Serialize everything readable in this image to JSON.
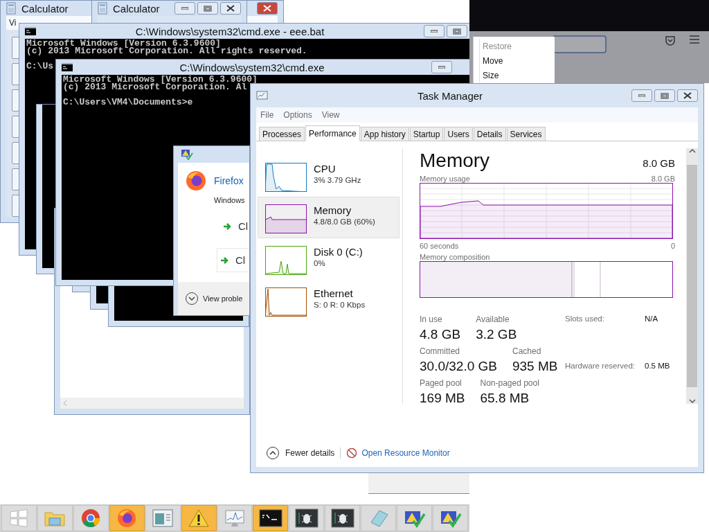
{
  "calculators": [
    {
      "title": "Calculator",
      "menu": [
        "Vi"
      ],
      "active": true
    },
    {
      "title": "Calculator",
      "active": false
    }
  ],
  "consoles": [
    {
      "title": "C:\\Windows\\system32\\cmd.exe - eee.bat",
      "output": [
        "Microsoft Windows [Version 6.3.9600]",
        "(c) 2013 Microsoft Corporation. All rights reserved."
      ],
      "prompt": "C:\\Us"
    },
    {
      "title": "C:\\Windows\\system32\\cmd.exe",
      "output": [
        "Microsoft Windows [Version 6.3.9600]",
        "(c) 2013 Microsoft Corporation. Al"
      ],
      "prompt": "C:\\Users\\VM4\\Documents>e"
    }
  ],
  "firefox_dialog": {
    "app": "Firefox",
    "message": "Windows",
    "options": [
      "Cl",
      "Cl"
    ],
    "details_button": "View proble"
  },
  "context_menu": [
    {
      "label": "Restore",
      "disabled": true
    },
    {
      "label": "Move",
      "disabled": false
    },
    {
      "label": "Size",
      "disabled": false
    }
  ],
  "task_manager": {
    "title": "Task Manager",
    "menu": [
      "File",
      "Options",
      "View"
    ],
    "tabs": [
      {
        "label": "Processes",
        "selected": false
      },
      {
        "label": "Performance",
        "selected": true
      },
      {
        "label": "App history",
        "selected": false
      },
      {
        "label": "Startup",
        "selected": false
      },
      {
        "label": "Users",
        "selected": false
      },
      {
        "label": "Details",
        "selected": false
      },
      {
        "label": "Services",
        "selected": false
      }
    ],
    "resources": [
      {
        "kind": "cpu",
        "name": "CPU",
        "detail": "3%  3.79 GHz",
        "selected": false,
        "color": "#117dbb"
      },
      {
        "kind": "memory",
        "name": "Memory",
        "detail": "4.8/8.0 GB (60%)",
        "selected": true,
        "color": "#8b12ae"
      },
      {
        "kind": "disk",
        "name": "Disk 0 (C:)",
        "detail": "0%",
        "selected": false,
        "color": "#4da60c"
      },
      {
        "kind": "network",
        "name": "Ethernet",
        "detail": "S: 0 R: 0 Kbps",
        "selected": false,
        "color": "#a74f01"
      }
    ],
    "panel": {
      "title": "Memory",
      "total": "8.0 GB",
      "usage_label": "Memory usage",
      "usage_max": "8.0 GB",
      "axis_start": "60 seconds",
      "axis_end": "0",
      "composition_label": "Memory composition",
      "stats": [
        [
          {
            "label": "In use",
            "value": "4.8 GB"
          },
          {
            "label": "Available",
            "value": "3.2 GB"
          }
        ],
        [
          {
            "label": "Committed",
            "value": "30.0/32.0 GB"
          },
          {
            "label": "Cached",
            "value": "935 MB"
          }
        ],
        [
          {
            "label": "Paged pool",
            "value": "169 MB"
          },
          {
            "label": "Non-paged pool",
            "value": "65.8 MB"
          }
        ]
      ],
      "side_stats": [
        {
          "label": "Slots used:",
          "value": "N/A"
        },
        {
          "label": "Hardware reserved:",
          "value": "0.5 MB"
        }
      ]
    },
    "fewer_details": "Fewer details",
    "resource_monitor_link": "Open Resource Monitor"
  },
  "taskbar": [
    {
      "kind": "start",
      "flashing": false
    },
    {
      "kind": "explorer",
      "flashing": false
    },
    {
      "kind": "chrome",
      "flashing": false
    },
    {
      "kind": "firefox",
      "flashing": true
    },
    {
      "kind": "app-window",
      "flashing": false
    },
    {
      "kind": "warning",
      "flashing": true
    },
    {
      "kind": "resource-monitor",
      "flashing": false
    },
    {
      "kind": "console",
      "flashing": true
    },
    {
      "kind": "debugger",
      "flashing": false
    },
    {
      "kind": "debugger",
      "flashing": false
    },
    {
      "kind": "notepad",
      "flashing": false
    },
    {
      "kind": "security",
      "flashing": false
    },
    {
      "kind": "security",
      "flashing": false
    }
  ]
}
